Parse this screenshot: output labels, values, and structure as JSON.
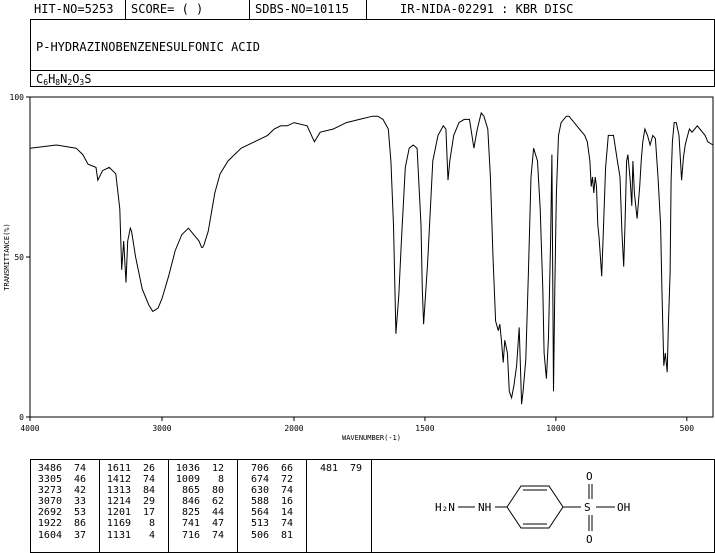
{
  "header": {
    "hit_no": "HIT-NO=5253",
    "score": "SCORE=  (  )",
    "sdbs_no": "SDBS-NO=10115",
    "ir_nida": "IR-NIDA-02291 : KBR DISC"
  },
  "compound": {
    "name": "P-HYDRAZINOBENZENESULFONIC ACID",
    "formula_parts": [
      "C",
      "6",
      "H",
      "8",
      "N",
      "2",
      "O",
      "3",
      "S"
    ]
  },
  "chart_data": {
    "type": "line",
    "xlabel": "WAVENUMBER(-1)",
    "ylabel": "TRANSMITTANCE(%)",
    "xlim": [
      4000,
      400
    ],
    "ylim": [
      0,
      100
    ],
    "x_ticks": [
      4000,
      3000,
      2000,
      1500,
      1000,
      500
    ],
    "y_ticks": [
      0,
      50,
      100
    ],
    "grid": false,
    "series": [
      {
        "x": [
          4000,
          3800,
          3650,
          3600,
          3560,
          3500,
          3486,
          3450,
          3400,
          3350,
          3320,
          3305,
          3290,
          3273,
          3260,
          3240,
          3230,
          3200,
          3150,
          3100,
          3070,
          3030,
          3000,
          2950,
          2900,
          2850,
          2800,
          2760,
          2740,
          2720,
          2700,
          2692,
          2680,
          2650,
          2600,
          2560,
          2500,
          2400,
          2300,
          2200,
          2150,
          2100,
          2050,
          2000,
          1950,
          1922,
          1900,
          1850,
          1800,
          1750,
          1700,
          1680,
          1660,
          1640,
          1630,
          1620,
          1611,
          1600,
          1590,
          1575,
          1560,
          1545,
          1530,
          1515,
          1510,
          1505,
          1490,
          1470,
          1450,
          1430,
          1420,
          1412,
          1405,
          1390,
          1370,
          1350,
          1330,
          1313,
          1300,
          1285,
          1275,
          1260,
          1250,
          1240,
          1230,
          1220,
          1214,
          1208,
          1201,
          1195,
          1185,
          1178,
          1169,
          1160,
          1150,
          1140,
          1131,
          1125,
          1115,
          1105,
          1095,
          1085,
          1070,
          1060,
          1050,
          1045,
          1036,
          1028,
          1020,
          1015,
          1009,
          1004,
          998,
          990,
          980,
          970,
          960,
          950,
          940,
          930,
          920,
          910,
          900,
          890,
          880,
          870,
          865,
          860,
          855,
          850,
          845,
          840,
          835,
          830,
          825,
          820,
          810,
          800,
          780,
          765,
          755,
          748,
          741,
          736,
          730,
          725,
          716,
          710,
          706,
          700,
          690,
          680,
          674,
          668,
          660,
          650,
          640,
          630,
          620,
          610,
          600,
          595,
          588,
          582,
          575,
          570,
          564,
          560,
          555,
          548,
          540,
          530,
          520,
          513,
          506,
          500,
          490,
          480,
          470,
          460,
          450,
          440,
          430,
          420,
          400
        ],
        "y": [
          84,
          85,
          84,
          82,
          79,
          78,
          74,
          77,
          78,
          76,
          65,
          46,
          55,
          42,
          55,
          59,
          58,
          50,
          40,
          35,
          33,
          34,
          37,
          44,
          52,
          57,
          59,
          57,
          56,
          55,
          53,
          53,
          54,
          58,
          70,
          76,
          80,
          84,
          86,
          88,
          90,
          91,
          91,
          92,
          91,
          86,
          89,
          90,
          92,
          93,
          94,
          94,
          93,
          90,
          80,
          60,
          26,
          38,
          55,
          78,
          84,
          85,
          84,
          60,
          40,
          29,
          48,
          80,
          88,
          91,
          90,
          74,
          80,
          88,
          92,
          93,
          93,
          84,
          90,
          95,
          94,
          90,
          75,
          50,
          30,
          27,
          29,
          24,
          17,
          24,
          20,
          8,
          6,
          10,
          16,
          28,
          4,
          8,
          18,
          45,
          75,
          84,
          80,
          65,
          40,
          20,
          12,
          25,
          55,
          82,
          8,
          40,
          70,
          88,
          92,
          93,
          94,
          94,
          93,
          92,
          91,
          90,
          89,
          88,
          86,
          80,
          72,
          75,
          70,
          75,
          72,
          60,
          56,
          50,
          44,
          55,
          78,
          88,
          88,
          80,
          75,
          58,
          47,
          60,
          80,
          82,
          74,
          66,
          80,
          70,
          62,
          72,
          80,
          86,
          90,
          88,
          85,
          88,
          87,
          75,
          60,
          40,
          16,
          20,
          14,
          30,
          45,
          74,
          86,
          92,
          92,
          88,
          74,
          81,
          85,
          87,
          90,
          89,
          90,
          91,
          90,
          89,
          88,
          86,
          85
        ]
      }
    ],
    "peak_table": [
      [
        [
          3486,
          74
        ],
        [
          3305,
          46
        ],
        [
          3273,
          42
        ],
        [
          3070,
          33
        ],
        [
          2692,
          53
        ],
        [
          1922,
          86
        ],
        [
          1604,
          37
        ]
      ],
      [
        [
          1611,
          26
        ],
        [
          1412,
          74
        ],
        [
          1313,
          84
        ],
        [
          1214,
          29
        ],
        [
          1201,
          17
        ],
        [
          1169,
          8
        ],
        [
          1131,
          4
        ]
      ],
      [
        [
          1036,
          12
        ],
        [
          1009,
          8
        ],
        [
          865,
          80
        ],
        [
          846,
          62
        ],
        [
          825,
          44
        ],
        [
          741,
          47
        ],
        [
          716,
          74
        ]
      ],
      [
        [
          706,
          66
        ],
        [
          674,
          72
        ],
        [
          630,
          74
        ],
        [
          588,
          16
        ],
        [
          564,
          14
        ],
        [
          513,
          74
        ],
        [
          506,
          81
        ]
      ],
      [
        [
          481,
          79
        ]
      ]
    ]
  },
  "structure": {
    "nh2_label": "H₂N",
    "nh_label": "NH",
    "s_label": "S",
    "o_top_label": "O",
    "o_bottom_label": "O",
    "oh_label": "OH"
  }
}
